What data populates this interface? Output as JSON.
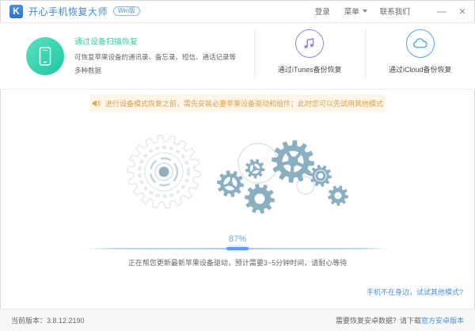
{
  "app": {
    "logo_letter": "K",
    "title": "开心手机恢复大师",
    "badge": "Win版"
  },
  "titlebar": {
    "login": "登录",
    "menu": "菜单",
    "contact": "联系我们",
    "minimize": "—",
    "close": "×"
  },
  "modes": {
    "device": {
      "title": "通过设备扫描恢复",
      "description": "可恢复苹果设备的通讯录、备忘录、短信、通话记录等多种数据"
    },
    "itunes": {
      "label": "通过iTunes备份恢复"
    },
    "icloud": {
      "label": "通过iCloud备份恢复"
    }
  },
  "notice": {
    "text": "进行设备模式恢复之前，需先安装必要苹果设备驱动和组件；此时您可以先试用其他模式"
  },
  "progress": {
    "percent": 87,
    "percent_label": "87%",
    "status": "正在帮您更新最新苹果设备驱动，预计需要3~5分钟时间，请耐心等待"
  },
  "links": {
    "other_modes": "手机不在身边，试试其他模式?"
  },
  "footer": {
    "version": "当前版本：3.8.12.2190",
    "android_prompt": "需要恢复安卓数据？请下载",
    "android_link": "官方安卓版本"
  },
  "colors": {
    "accent_blue": "#4a90e2",
    "brand_blue": "#3b7fd8",
    "device_green": "#2fcda6",
    "itunes_purple": "#9184ea",
    "icloud_blue": "#4ba5f0",
    "notice_text": "#df9f4a",
    "notice_bg": "#fcf6e8",
    "gear_blue": "#8aafc2",
    "gear_light_stroke": "#e2eaee",
    "gear_center_dot": "#93afbb"
  }
}
